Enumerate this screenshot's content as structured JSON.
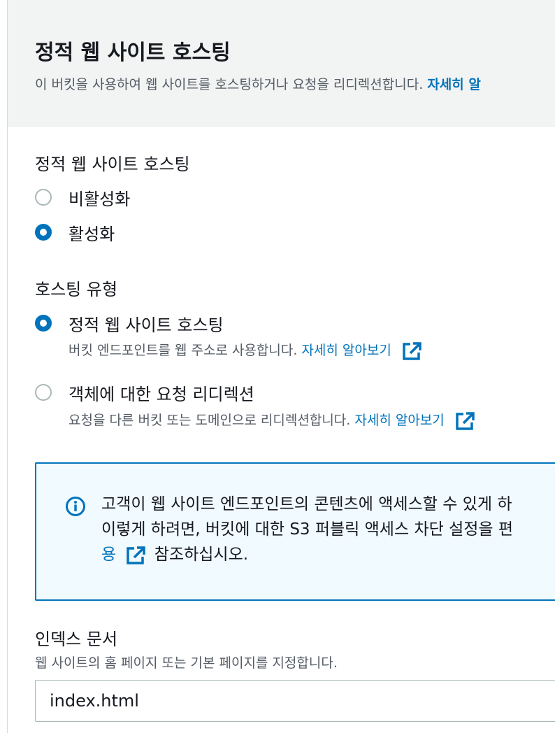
{
  "header": {
    "title": "정적 웹 사이트 호스팅",
    "description": "이 버킷을 사용하여 웹 사이트를 호스팅하거나 요청을 리디렉션합니다.",
    "learn_more": "자세히 알"
  },
  "hosting": {
    "label": "정적 웹 사이트 호스팅",
    "options": [
      {
        "label": "비활성화",
        "selected": false
      },
      {
        "label": "활성화",
        "selected": true
      }
    ]
  },
  "hosting_type": {
    "label": "호스팅 유형",
    "options": [
      {
        "label": "정적 웹 사이트 호스팅",
        "description": "버킷 엔드포인트를 웹 주소로 사용합니다.",
        "link": "자세히 알아보기",
        "selected": true
      },
      {
        "label": "객체에 대한 요청 리디렉션",
        "description": "요청을 다른 버킷 또는 도메인으로 리디렉션합니다.",
        "link": "자세히 알아보기",
        "selected": false
      }
    ]
  },
  "info": {
    "line1": "고객이 웹 사이트 엔드포인트의 콘텐츠에 액세스할 수 있게 하",
    "line2": "이렇게 하려면, 버킷에 대한 S3 퍼블릭 액세스 차단 설정을 편",
    "line3_link": "용",
    "line3_text": "참조하십시오."
  },
  "index_document": {
    "label": "인덱스 문서",
    "description": "웹 사이트의 홈 페이지 또는 기본 페이지를 지정합니다.",
    "value": "index.html"
  },
  "colors": {
    "accent": "#0073bb",
    "header_bg": "#f2f3f3",
    "info_bg": "#f1faff"
  }
}
